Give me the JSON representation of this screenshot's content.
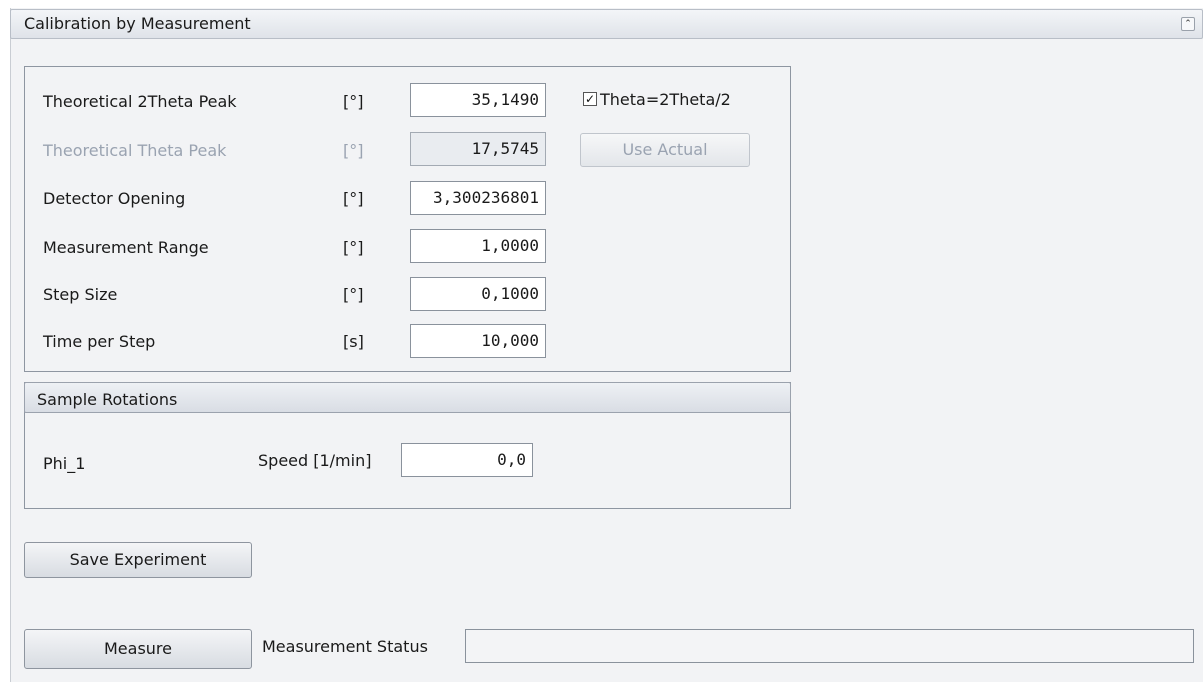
{
  "panel": {
    "title": "Calibration by Measurement",
    "collapse_glyph": "⌃"
  },
  "params": {
    "theoretical_2theta": {
      "label": "Theoretical 2Theta Peak",
      "unit": "[°]",
      "value": "35,1490"
    },
    "theoretical_theta": {
      "label": "Theoretical Theta Peak",
      "unit": "[°]",
      "value": "17,5745"
    },
    "detector_opening": {
      "label": "Detector Opening",
      "unit": "[°]",
      "value": "3,300236801"
    },
    "measurement_range": {
      "label": "Measurement Range",
      "unit": "[°]",
      "value": "1,0000"
    },
    "step_size": {
      "label": "Step Size",
      "unit": "[°]",
      "value": "0,1000"
    },
    "time_per_step": {
      "label": "Time per Step",
      "unit": "[s]",
      "value": "10,000"
    }
  },
  "theta_checkbox": {
    "label": "Theta=2Theta/2",
    "checked": true,
    "mark": "✓"
  },
  "use_actual_label": "Use Actual",
  "sample_rotations": {
    "title": "Sample Rotations",
    "axis_label": "Phi_1",
    "speed_label": "Speed [1/min]",
    "speed_value": "0,0"
  },
  "save_experiment_label": "Save Experiment",
  "measure_label": "Measure",
  "status": {
    "label": "Measurement Status",
    "value": ""
  }
}
